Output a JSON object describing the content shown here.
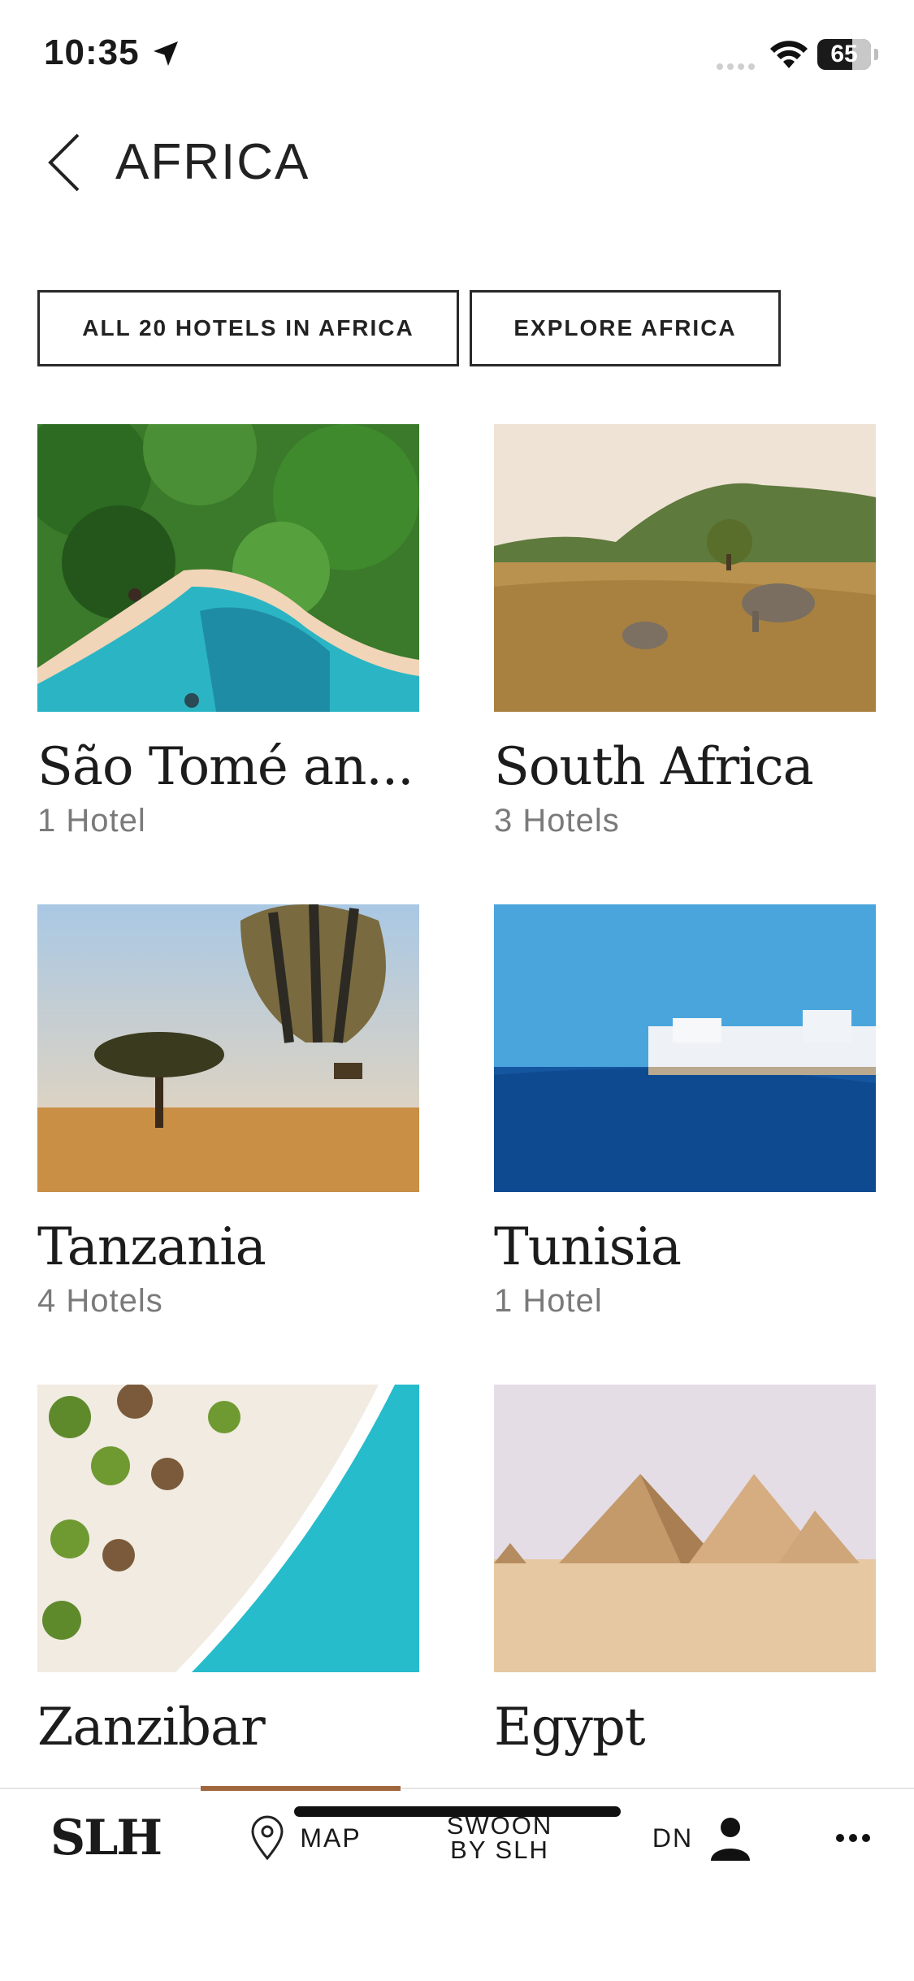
{
  "status_bar": {
    "time": "10:35",
    "battery": "65"
  },
  "header": {
    "title": "AFRICA"
  },
  "filters": {
    "all_hotels": "ALL 20 HOTELS IN AFRICA",
    "explore": "EXPLORE AFRICA"
  },
  "destinations": [
    {
      "name": "São Tomé an...",
      "count": "1 Hotel"
    },
    {
      "name": "South Africa",
      "count": "3 Hotels"
    },
    {
      "name": "Tanzania",
      "count": "4 Hotels"
    },
    {
      "name": "Tunisia",
      "count": "1 Hotel"
    },
    {
      "name": "Zanzibar",
      "count": ""
    },
    {
      "name": "Egypt",
      "count": ""
    }
  ],
  "tabbar": {
    "logo": "SLH",
    "map": "MAP",
    "swoon_line1": "SWOON",
    "swoon_line2": "BY SLH",
    "account": "DN"
  },
  "icons": {
    "back": "chevron-left-icon",
    "map": "location-pin-icon",
    "account": "person-icon",
    "more": "ellipsis-icon"
  },
  "colors": {
    "accent": "#a0673f",
    "text_secondary": "#7a7a7a"
  }
}
